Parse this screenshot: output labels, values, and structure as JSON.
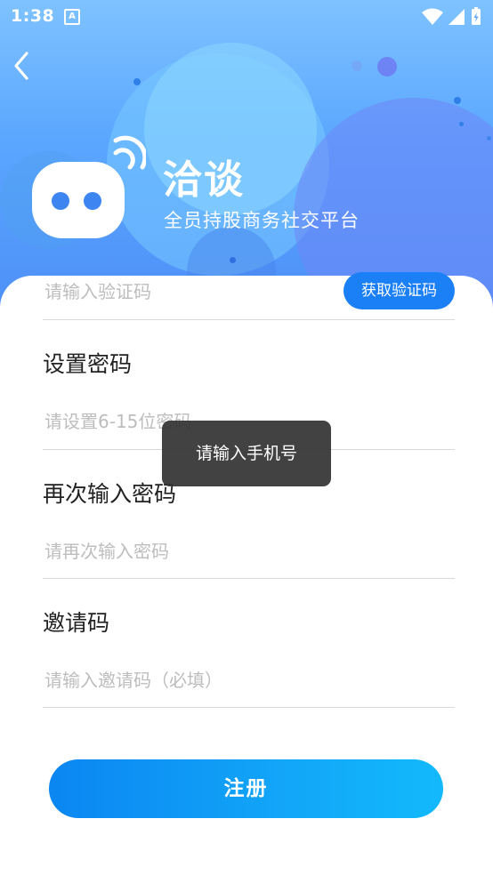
{
  "status_bar": {
    "time": "1:38",
    "notification_icon": "A"
  },
  "header": {
    "back_icon": "chevron-left",
    "brand_title": "洽谈",
    "brand_subtitle": "全员持股商务社交平台"
  },
  "form": {
    "verification_code": {
      "placeholder": "请输入验证码",
      "button_label": "获取验证码"
    },
    "password": {
      "label": "设置密码",
      "placeholder": "请设置6-15位密码"
    },
    "confirm_password": {
      "label": "再次输入密码",
      "placeholder": "请再次输入密码"
    },
    "invite_code": {
      "label": "邀请码",
      "placeholder": "请输入邀请码（必填）"
    }
  },
  "toast": {
    "message": "请输入手机号"
  },
  "register_button": {
    "label": "注册"
  },
  "colors": {
    "accent": "#1b7ff5",
    "header_gradient_top": "#7ec2ff",
    "header_gradient_bottom": "#4d8ef7",
    "toast_bg": "#323232"
  }
}
